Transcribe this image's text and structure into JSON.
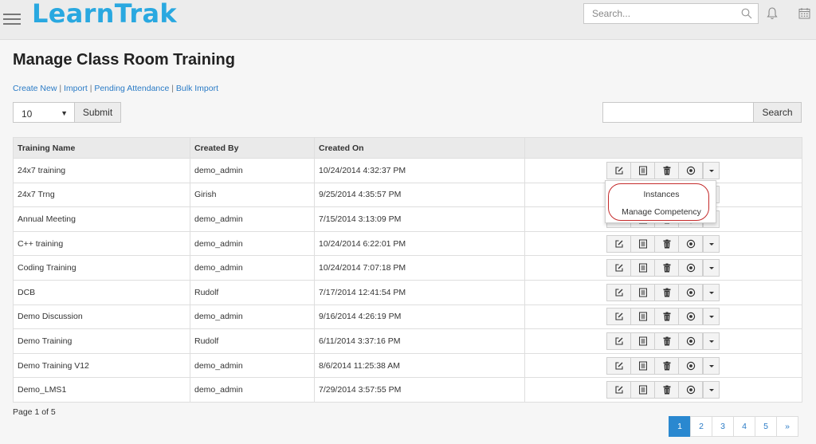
{
  "header": {
    "app_name": "LearnTrak",
    "search_placeholder": "Search..."
  },
  "page": {
    "title": "Manage Class Room Training",
    "links": [
      {
        "label": "Create New"
      },
      {
        "label": "Import"
      },
      {
        "label": "Pending Attendance"
      },
      {
        "label": "Bulk Import"
      }
    ],
    "link_separator": " | "
  },
  "toolbar": {
    "page_size": "10",
    "submit_label": "Submit",
    "search_button_label": "Search"
  },
  "table": {
    "columns": [
      "Training Name",
      "Created By",
      "Created On",
      ""
    ],
    "rows": [
      {
        "name": "24x7 training",
        "created_by": "demo_admin",
        "created_on": "10/24/2014 4:32:37 PM"
      },
      {
        "name": "24x7 Trng",
        "created_by": "Girish",
        "created_on": "9/25/2014 4:35:57 PM"
      },
      {
        "name": "Annual Meeting",
        "created_by": "demo_admin",
        "created_on": "7/15/2014 3:13:09 PM"
      },
      {
        "name": "C++ training",
        "created_by": "demo_admin",
        "created_on": "10/24/2014 6:22:01 PM"
      },
      {
        "name": "Coding Training",
        "created_by": "demo_admin",
        "created_on": "10/24/2014 7:07:18 PM"
      },
      {
        "name": "DCB",
        "created_by": "Rudolf",
        "created_on": "7/17/2014 12:41:54 PM"
      },
      {
        "name": "Demo Discussion",
        "created_by": "demo_admin",
        "created_on": "9/16/2014 4:26:19 PM"
      },
      {
        "name": "Demo Training",
        "created_by": "Rudolf",
        "created_on": "6/11/2014 3:37:16 PM"
      },
      {
        "name": "Demo Training V12",
        "created_by": "demo_admin",
        "created_on": "8/6/2014 11:25:38 AM"
      },
      {
        "name": "Demo_LMS1",
        "created_by": "demo_admin",
        "created_on": "7/29/2014 3:57:55 PM"
      }
    ],
    "row_action_icons": [
      "edit-icon",
      "list-icon",
      "trash-icon",
      "stop-circle-icon",
      "caret-down-icon"
    ]
  },
  "dropdown_menu": {
    "items": [
      "Instances",
      "Manage Competency"
    ],
    "highlight_color": "#c42b2b"
  },
  "footer": {
    "page_info": "Page 1 of 5",
    "pages": [
      "1",
      "2",
      "3",
      "4",
      "5",
      "»"
    ],
    "active_page": "1"
  },
  "colors": {
    "brand": "#29a8e0",
    "link": "#2a7bc6",
    "active_page": "#2a88d0"
  }
}
